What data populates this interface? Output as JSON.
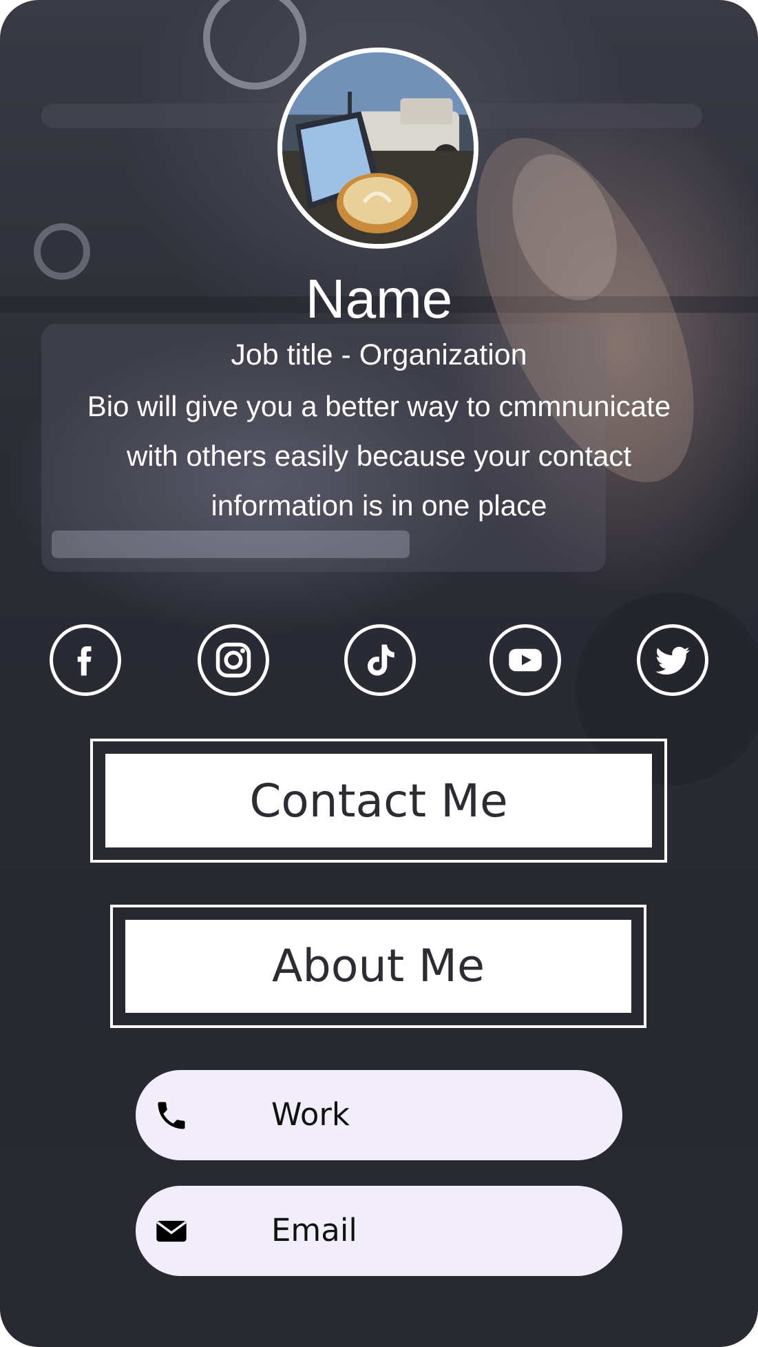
{
  "profile": {
    "name": "Name",
    "job": "Job title - Organization",
    "bio": "Bio will give you a better way to cmmnunicate with others easily because your contact information is in one place"
  },
  "social": [
    {
      "icon": "facebook-icon"
    },
    {
      "icon": "instagram-icon"
    },
    {
      "icon": "tiktok-icon"
    },
    {
      "icon": "youtube-icon"
    },
    {
      "icon": "twitter-icon"
    }
  ],
  "buttons": {
    "contact_label": "Contact Me",
    "about_label": "About Me"
  },
  "contacts": [
    {
      "icon": "phone-icon",
      "label": "Work"
    },
    {
      "icon": "envelope-icon",
      "label": "Email"
    }
  ],
  "colors": {
    "text": "#ffffff",
    "button_text": "#2c2c33",
    "pill_bg": "#f1eef9",
    "background": "#2b2b33"
  }
}
